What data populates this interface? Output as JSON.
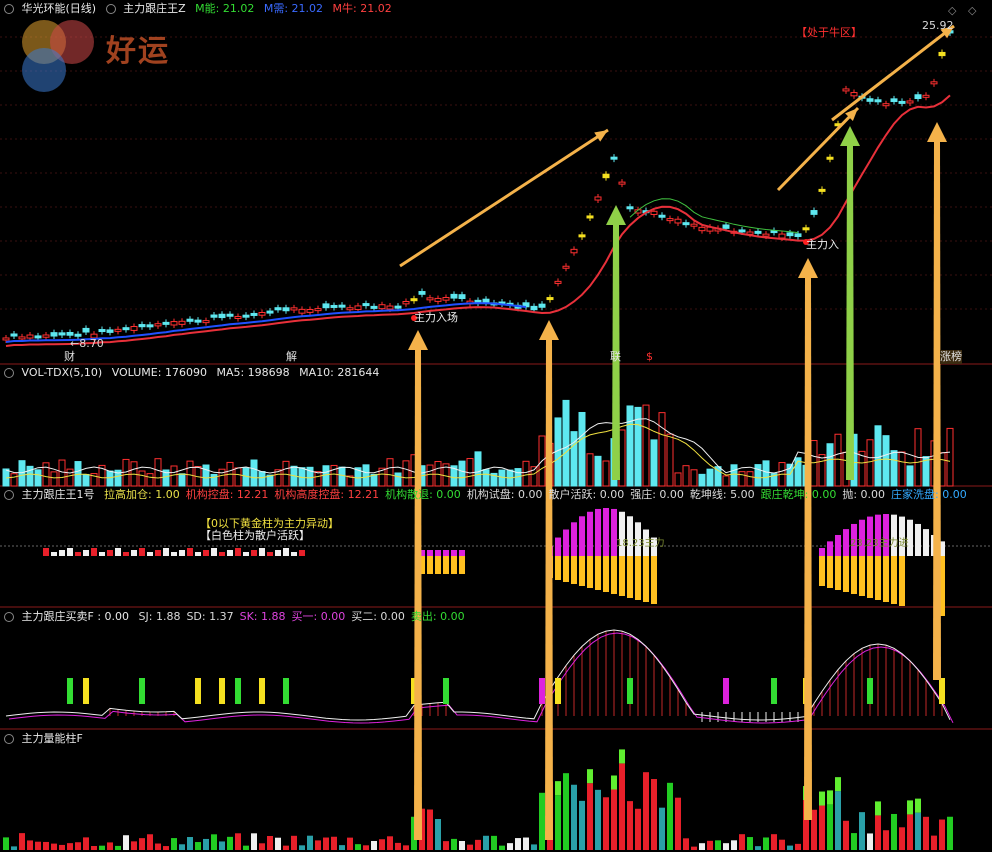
{
  "main": {
    "title": "华光环能(日线)",
    "indicator": "主力跟庄王Z",
    "m_neng_label": "M能: 21.02",
    "m_xu_label": "M需: 21.02",
    "m_niu_label": "M牛: 21.02",
    "price_high": "25.92",
    "price_low": "←8.70",
    "niu_zone": "【处于牛区】",
    "entry_labels": [
      "主力入场",
      "主力入场",
      "主力入"
    ],
    "bottom_marks": [
      "财",
      "解",
      "联",
      "$",
      "涨榜"
    ],
    "watermark": "好运"
  },
  "volume": {
    "header": "VOL-TDX(5,10)",
    "volume": "VOLUME: 176090",
    "ma5": "MA5: 198698",
    "ma10": "MA10: 281644"
  },
  "ind1": {
    "name": "主力跟庄王1号",
    "items": [
      {
        "t": "拉高加仓: 1.00",
        "c": "#e8e04a"
      },
      {
        "t": "机构控盘: 12.21",
        "c": "#ff4040"
      },
      {
        "t": "机构高度控盘: 12.21",
        "c": "#ff4040"
      },
      {
        "t": "机构散退: 0.00",
        "c": "#33dd33"
      },
      {
        "t": "机构试盘: 0.00",
        "c": "#d9d9d9"
      },
      {
        "t": "散户活跃: 0.00",
        "c": "#d9d9d9"
      },
      {
        "t": "强庄: 0.00",
        "c": "#d9d9d9"
      },
      {
        "t": "乾坤线: 5.00",
        "c": "#d9d9d9"
      },
      {
        "t": "跟庄乾坤: 0.00",
        "c": "#33dd33"
      },
      {
        "t": "抛: 0.00",
        "c": "#d9d9d9"
      },
      {
        "t": "庄家洗盘: 0.00",
        "c": "#33aaff"
      }
    ],
    "note1": "【0以下黄金柱为主力异动】",
    "note2": "【白色柱为散户活跃】",
    "mark1": "18.23主力",
    "mark2": "23.23主力进"
  },
  "ind2": {
    "name": "主力跟庄买卖F : 0.00",
    "items": [
      {
        "t": "SJ: 1.88",
        "c": "#d9d9d9"
      },
      {
        "t": "SD: 1.37",
        "c": "#d9d9d9"
      },
      {
        "t": "SK: 1.88",
        "c": "#dd44dd"
      },
      {
        "t": "买一: 0.00",
        "c": "#dd44dd"
      },
      {
        "t": "买二: 0.00",
        "c": "#d9d9d9"
      },
      {
        "t": "卖出: 0.00",
        "c": "#33dd33"
      }
    ]
  },
  "ind3": {
    "name": "主力量能柱F"
  },
  "colors": {
    "up": "#ff3030",
    "down": "#5ee8f0",
    "ma_red": "#e8303a",
    "ma_blue": "#2050ff",
    "gold": "#ffc020",
    "magenta": "#dd22dd",
    "arrow": "#f4b24a",
    "arrow_green": "#8fd048",
    "divider": "#8a1a1a"
  }
}
